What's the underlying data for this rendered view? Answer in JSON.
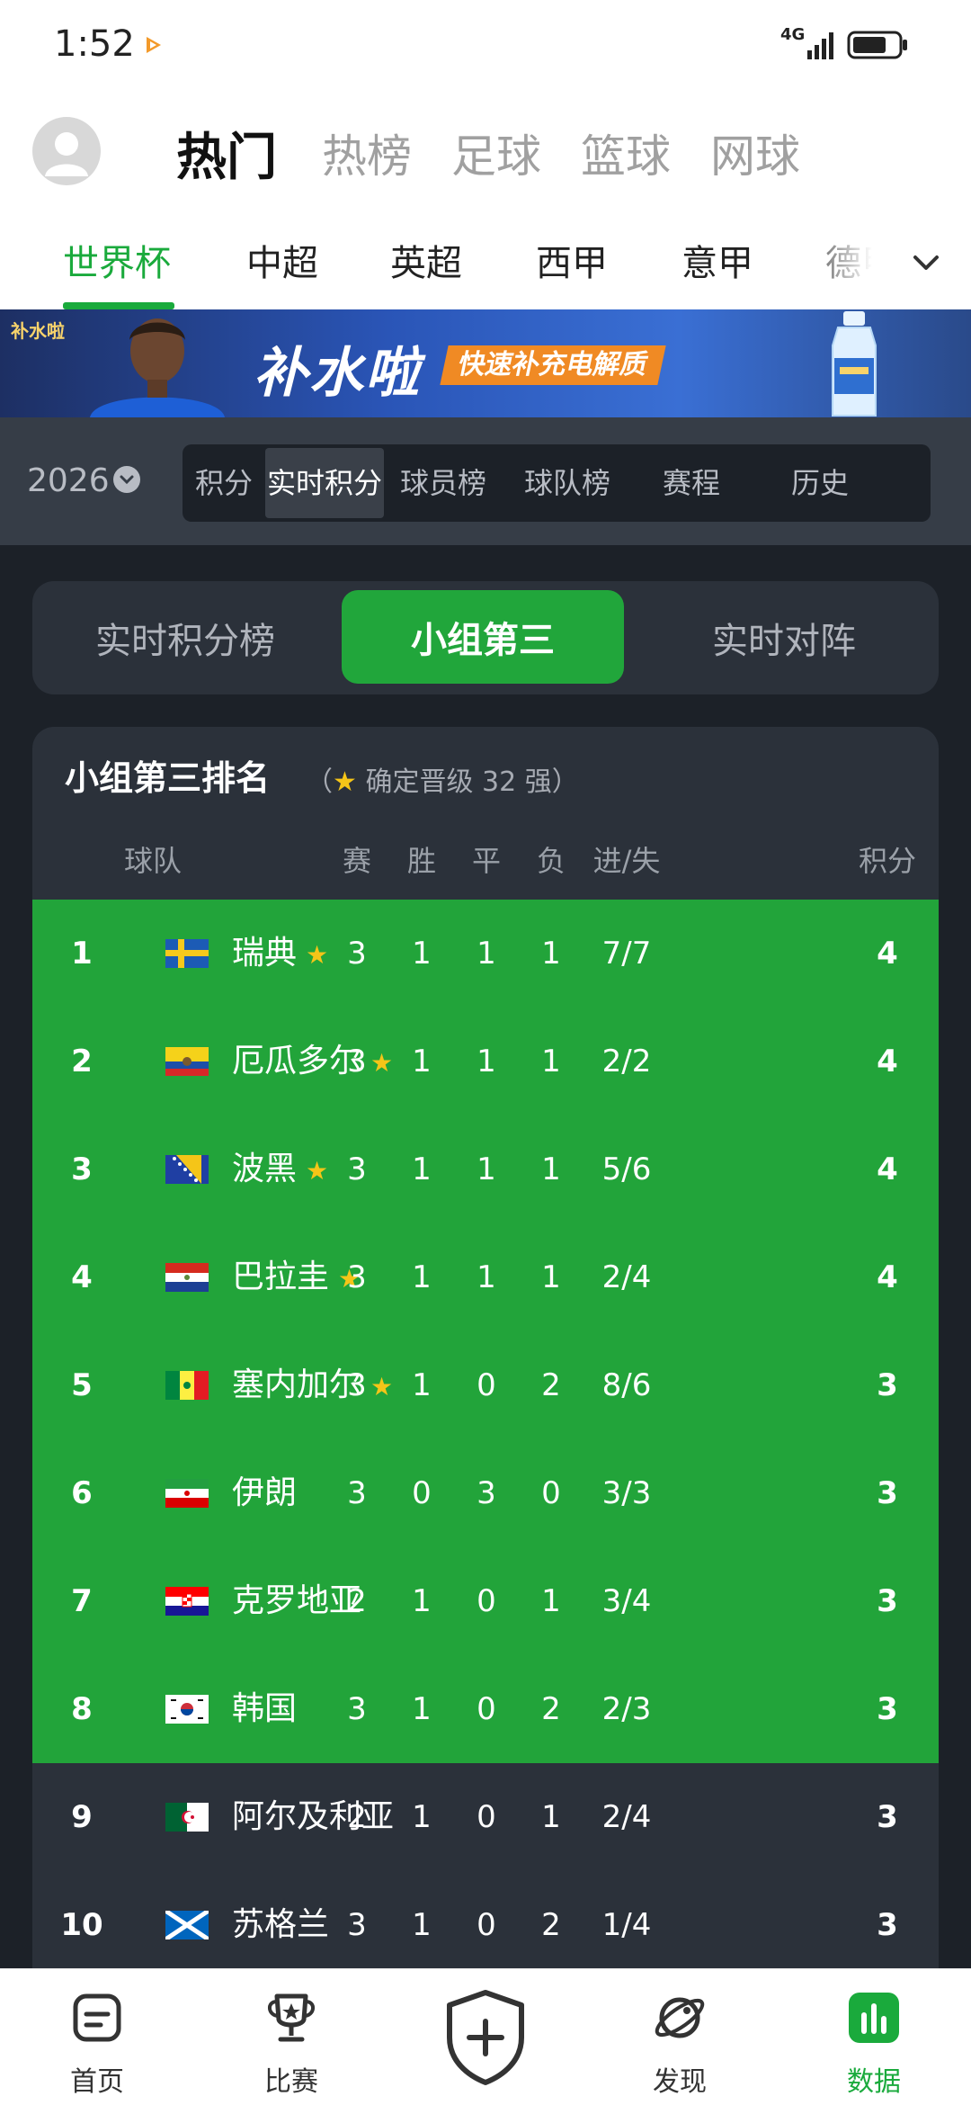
{
  "status": {
    "time": "1:52",
    "network": "4G"
  },
  "top_tabs": [
    {
      "label": "热门",
      "active": true
    },
    {
      "label": "热榜",
      "active": false
    },
    {
      "label": "足球",
      "active": false
    },
    {
      "label": "篮球",
      "active": false
    },
    {
      "label": "网球",
      "active": false
    }
  ],
  "league_tabs": [
    {
      "label": "世界杯",
      "active": true
    },
    {
      "label": "中超",
      "active": false
    },
    {
      "label": "英超",
      "active": false
    },
    {
      "label": "西甲",
      "active": false
    },
    {
      "label": "意甲",
      "active": false
    },
    {
      "label": "德甲",
      "active": false
    }
  ],
  "banner": {
    "logo": "补水啦",
    "title": "补水啦",
    "tag": "快速补充电解质"
  },
  "filter": {
    "season": "2026",
    "segments": [
      {
        "label": "积分",
        "active": false
      },
      {
        "label": "实时积分",
        "active": true
      },
      {
        "label": "球员榜",
        "active": false
      },
      {
        "label": "球队榜",
        "active": false
      },
      {
        "label": "赛程",
        "active": false
      },
      {
        "label": "历史",
        "active": false
      }
    ]
  },
  "subtabs": [
    {
      "label": "实时积分榜",
      "active": false
    },
    {
      "label": "小组第三",
      "active": true
    },
    {
      "label": "实时对阵",
      "active": false
    }
  ],
  "table": {
    "title": "小组第三排名",
    "note_open": "（",
    "note_star": "★",
    "note_text": " 确定晋级 32 强）",
    "headers": {
      "team": "球队",
      "played": "赛",
      "won": "胜",
      "draw": "平",
      "lost": "负",
      "goals": "进/失",
      "points": "积分"
    },
    "rows": [
      {
        "rank": "1",
        "team": "瑞典",
        "flag": "sweden",
        "star": true,
        "played": "3",
        "won": "1",
        "draw": "1",
        "lost": "1",
        "goals": "7/7",
        "points": "4",
        "qualified": true
      },
      {
        "rank": "2",
        "team": "厄瓜多尔",
        "flag": "ecuador",
        "star": true,
        "played": "3",
        "won": "1",
        "draw": "1",
        "lost": "1",
        "goals": "2/2",
        "points": "4",
        "qualified": true
      },
      {
        "rank": "3",
        "team": "波黑",
        "flag": "bosnia",
        "star": true,
        "played": "3",
        "won": "1",
        "draw": "1",
        "lost": "1",
        "goals": "5/6",
        "points": "4",
        "qualified": true
      },
      {
        "rank": "4",
        "team": "巴拉圭",
        "flag": "paraguay",
        "star": true,
        "played": "3",
        "won": "1",
        "draw": "1",
        "lost": "1",
        "goals": "2/4",
        "points": "4",
        "qualified": true
      },
      {
        "rank": "5",
        "team": "塞内加尔",
        "flag": "senegal",
        "star": true,
        "played": "3",
        "won": "1",
        "draw": "0",
        "lost": "2",
        "goals": "8/6",
        "points": "3",
        "qualified": true
      },
      {
        "rank": "6",
        "team": "伊朗",
        "flag": "iran",
        "star": false,
        "played": "3",
        "won": "0",
        "draw": "3",
        "lost": "0",
        "goals": "3/3",
        "points": "3",
        "qualified": true
      },
      {
        "rank": "7",
        "team": "克罗地亚",
        "flag": "croatia",
        "star": false,
        "played": "2",
        "won": "1",
        "draw": "0",
        "lost": "1",
        "goals": "3/4",
        "points": "3",
        "qualified": true
      },
      {
        "rank": "8",
        "team": "韩国",
        "flag": "korea",
        "star": false,
        "played": "3",
        "won": "1",
        "draw": "0",
        "lost": "2",
        "goals": "2/3",
        "points": "3",
        "qualified": true
      },
      {
        "rank": "9",
        "team": "阿尔及利亚",
        "flag": "algeria",
        "star": false,
        "played": "2",
        "won": "1",
        "draw": "0",
        "lost": "1",
        "goals": "2/4",
        "points": "3",
        "qualified": false
      },
      {
        "rank": "10",
        "team": "苏格兰",
        "flag": "scotland",
        "star": false,
        "played": "3",
        "won": "1",
        "draw": "0",
        "lost": "2",
        "goals": "1/4",
        "points": "3",
        "qualified": false
      }
    ]
  },
  "bottom_nav": [
    {
      "label": "首页",
      "icon": "home-icon",
      "active": false
    },
    {
      "label": "比赛",
      "icon": "trophy-icon",
      "active": false
    },
    {
      "label": "",
      "icon": "add-shield-icon",
      "active": false
    },
    {
      "label": "发现",
      "icon": "planet-icon",
      "active": false
    },
    {
      "label": "数据",
      "icon": "data-chart-icon",
      "active": true
    }
  ],
  "colors": {
    "accent": "#1aaa3c",
    "qualified_row": "#22a43a",
    "star": "#f5c518",
    "dark_bg": "#1c2128",
    "card_bg": "#2b313a"
  }
}
